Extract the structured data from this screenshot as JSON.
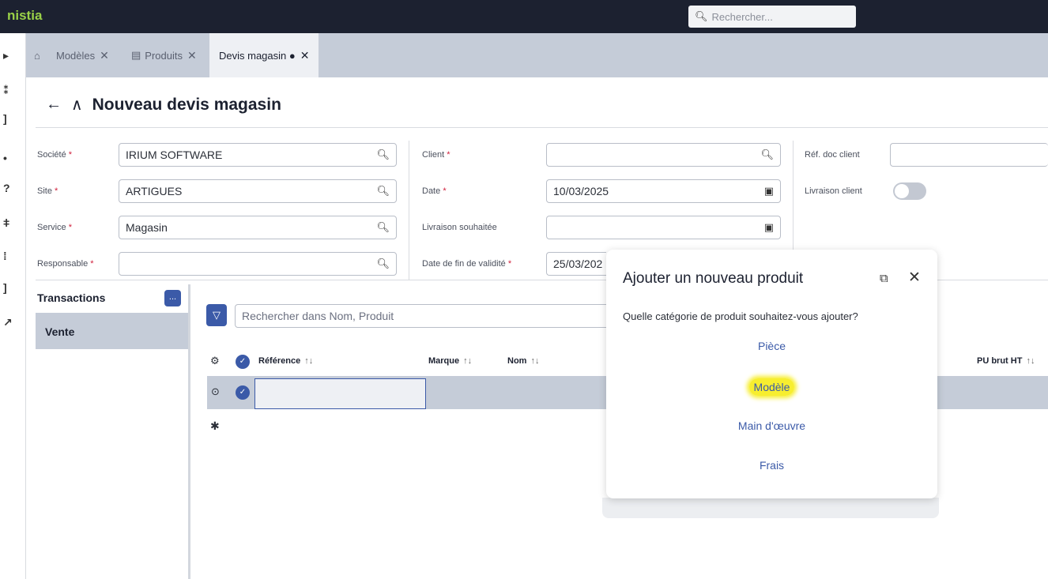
{
  "app": {
    "brand": "nistia"
  },
  "search": {
    "placeholder": "Rechercher..."
  },
  "tabs": [
    {
      "label": "Modèles"
    },
    {
      "label": "Produits"
    },
    {
      "label": "Devis magasin ●"
    }
  ],
  "page": {
    "title": "Nouveau devis magasin"
  },
  "form": {
    "societe": {
      "label": "Société",
      "value": "IRIUM SOFTWARE"
    },
    "site": {
      "label": "Site",
      "value": "ARTIGUES"
    },
    "service": {
      "label": "Service",
      "value": "Magasin"
    },
    "responsable": {
      "label": "Responsable",
      "value": ""
    },
    "client": {
      "label": "Client",
      "value": ""
    },
    "date": {
      "label": "Date",
      "value": "10/03/2025"
    },
    "livraison_souhaitee": {
      "label": "Livraison souhaitée",
      "value": ""
    },
    "date_fin_validite": {
      "label": "Date de fin de validité",
      "value": "25/03/202"
    },
    "ref_doc_client": {
      "label": "Réf. doc client",
      "value": ""
    },
    "livraison_client": {
      "label": "Livraison client"
    }
  },
  "transactions": {
    "title": "Transactions",
    "more": "...",
    "items": [
      "Vente"
    ]
  },
  "grid": {
    "search_placeholder": "Rechercher dans Nom, Produit",
    "columns": [
      "Référence",
      "Marque",
      "Nom",
      "PU brut HT"
    ],
    "sort_glyph": "↑↓",
    "new_row_marker": "✱"
  },
  "dialog": {
    "title": "Ajouter un nouveau produit",
    "question": "Quelle catégorie de produit souhaitez-vous ajouter?",
    "options": [
      "Pièce",
      "Modèle",
      "Main d'œuvre",
      "Frais"
    ]
  },
  "colors": {
    "accent": "#3b5aa8",
    "topbar": "#1c2130",
    "highlight": "#f7ee2f",
    "brand": "#9ad148"
  }
}
